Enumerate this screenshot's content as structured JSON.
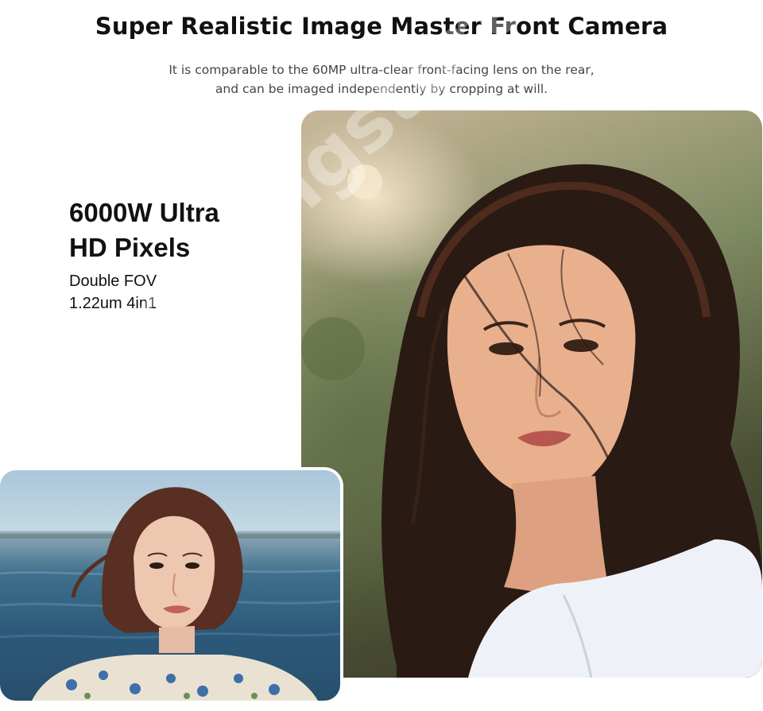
{
  "header": {
    "title": "Super Realistic Image Master Front Camera",
    "subtitle_lines": [
      "It is comparable to the 60MP ultra-clear front-facing lens on the rear,",
      "and can be imaged independently by cropping at will."
    ]
  },
  "feature": {
    "heading_lines": [
      "6000W Ultra",
      "HD Pixels"
    ],
    "spec_lines": [
      "Double FOV",
      "1.22um 4in1"
    ]
  },
  "photos": {
    "large": {
      "icon": "portrait-photo"
    },
    "small": {
      "icon": "seaside-portrait-photo"
    }
  },
  "watermark": {
    "text": "Pccmongstore"
  },
  "colors": {
    "title": "#111111",
    "subtitle": "#444444",
    "background": "#ffffff"
  }
}
